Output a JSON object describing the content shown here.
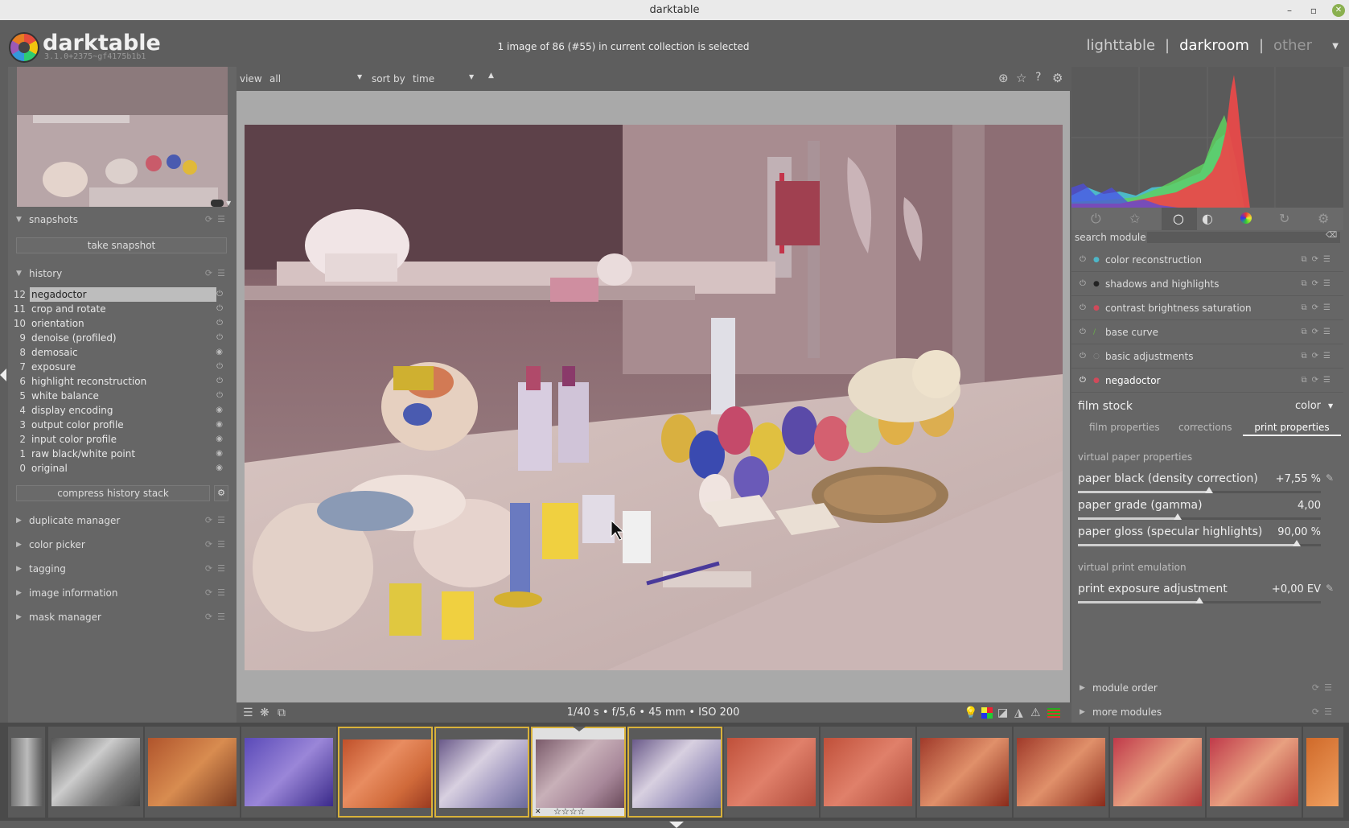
{
  "window": {
    "title": "darktable"
  },
  "header": {
    "app_name": "darktable",
    "app_version": "3.1.0+2375~gf4175b1b1",
    "selection_info": "1 image of 86 (#55) in current collection is selected",
    "views": {
      "lighttable": "lighttable",
      "darkroom": "darkroom",
      "other": "other",
      "separator": "|"
    }
  },
  "left": {
    "snapshots": {
      "title": "snapshots",
      "take_snapshot": "take snapshot"
    },
    "history": {
      "title": "history",
      "items": [
        {
          "num": "12",
          "label": "negadoctor"
        },
        {
          "num": "11",
          "label": "crop and rotate"
        },
        {
          "num": "10",
          "label": "orientation"
        },
        {
          "num": "9",
          "label": "denoise (profiled)"
        },
        {
          "num": "8",
          "label": "demosaic"
        },
        {
          "num": "7",
          "label": "exposure"
        },
        {
          "num": "6",
          "label": "highlight reconstruction"
        },
        {
          "num": "5",
          "label": "white balance"
        },
        {
          "num": "4",
          "label": "display encoding"
        },
        {
          "num": "3",
          "label": "output color profile"
        },
        {
          "num": "2",
          "label": "input color profile"
        },
        {
          "num": "1",
          "label": "raw black/white point"
        },
        {
          "num": "0",
          "label": "original"
        }
      ],
      "compress": "compress history stack"
    },
    "modules": [
      "duplicate manager",
      "color picker",
      "tagging",
      "image information",
      "mask manager"
    ]
  },
  "centerbar": {
    "view_label": "view",
    "view_value": "all",
    "sort_label": "sort by",
    "sort_value": "time"
  },
  "bottom_info": "1/40 s • f/5,6 • 45 mm • ISO 200",
  "right": {
    "search_label": "search module",
    "modules": [
      "color reconstruction",
      "shadows and highlights",
      "contrast brightness saturation",
      "base curve",
      "basic adjustments",
      "negadoctor"
    ],
    "film_stock_label": "film stock",
    "film_stock_value": "color",
    "tabs": [
      "film properties",
      "corrections",
      "print properties"
    ],
    "paper_header": "virtual paper properties",
    "sliders": [
      {
        "label": "paper black (density correction)",
        "value": "+7,55 %",
        "fraction": 0.54
      },
      {
        "label": "paper grade (gamma)",
        "value": "4,00",
        "fraction": 0.41
      },
      {
        "label": "paper gloss (specular highlights)",
        "value": "90,00 %",
        "fraction": 0.9
      }
    ],
    "print_header": "virtual print emulation",
    "print_slider": {
      "label": "print exposure adjustment",
      "value": "+0,00 EV",
      "fraction": 0.5
    },
    "footer": [
      "module order",
      "more modules"
    ]
  },
  "filmstrip": {
    "stars": "☆☆☆☆",
    "reject": "✕"
  }
}
